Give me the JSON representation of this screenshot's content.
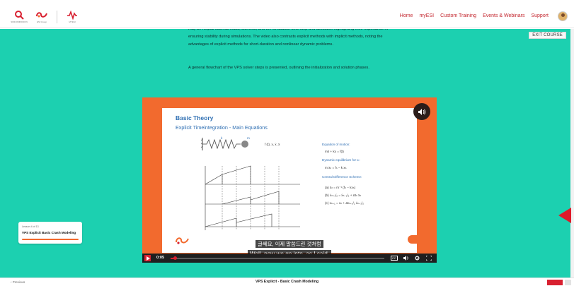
{
  "nav": {
    "logos": [
      {
        "icon": "simcompanion-logo-icon",
        "caption": "SIMCOMPANION"
      },
      {
        "icon": "esi-logo-icon",
        "caption": "ESI Group"
      },
      {
        "icon": "myesi-logo-icon",
        "caption": "MYESI"
      }
    ],
    "links": [
      "Home",
      "myESI",
      "Custom Training",
      "Events & Webinars",
      "Support"
    ],
    "avatar": "user-avatar-icon"
  },
  "content": {
    "exit_label": "EXIT COURSE",
    "paragraph_clip": "may be helpful such as mass, stiffness, and the simulation time step and allocation highlighting their importance in ensuring stability during simulations. The video also contrasts explicit methods with implicit methods, noting the advantages of explicit methods for short-duration and nonlinear dynamic problems.",
    "paragraph_2": "A general flowchart of the VPS solver steps is presented, outlining the initialization and solution phases."
  },
  "video": {
    "slide_title": "Basic Theory",
    "slide_subtitle": "Explicit Timeintegration - Main Equations",
    "equation_heading_1": "Equation of motion:",
    "equation_1": "mẍ + kx = f(t)",
    "equation_heading_2": "Dynamic equilibrium for tₙ:",
    "equation_2": "m ẍₙ = fₙ − k xₙ",
    "equation_heading_3": "Central Difference Scheme:",
    "equation_a": "(a)   ẍₙ = m⁻¹ (fₙ − kxₙ)",
    "equation_b": "(b)   ẋₙ₊₁/₂ = ẋₙ₋₁/₂ + Δtₙ ẍₙ",
    "equation_c": "(c)   xₙ₊₁ = xₙ + Δtₙ₊₁/₂ ẋₙ₊₁/₂",
    "spring_label_k": "k",
    "mass_label_m": "m",
    "force_label": "f (t), x, ẋ, ẍ",
    "subtitle_ko": "글쎄요, 이제 말씀드린 것처럼",
    "subtitle_en": "Well, now we go into, as I said,",
    "time": "0:05",
    "progress_fraction": 0.02
  },
  "lesson": {
    "kicker": "Lesson 4 of 13",
    "title": "VPS Explicit Basic Crash Modeling",
    "progress_fraction": 0.3
  },
  "bottom": {
    "previous": "‹ Previous",
    "title": "VPS Explicit - Basic Crash Modeling"
  },
  "colors": {
    "teal": "#1cd0b0",
    "orange": "#f26a2e",
    "red": "#d82030",
    "blue": "#2f6fb3"
  }
}
